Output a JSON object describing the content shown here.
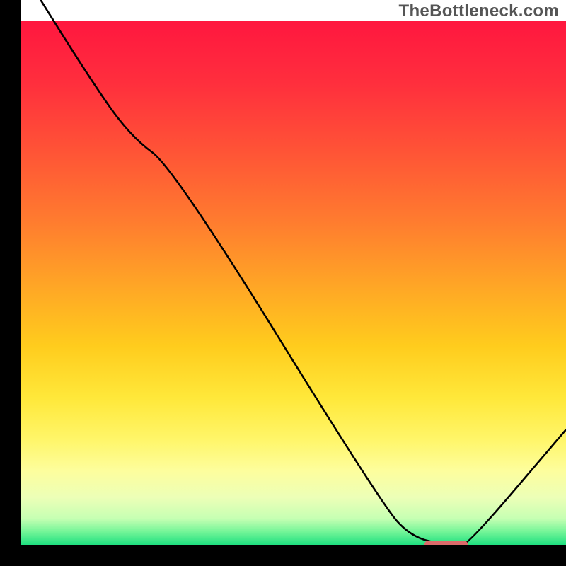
{
  "watermark": "TheBottleneck.com",
  "chart_data": {
    "type": "line",
    "title": "",
    "xlabel": "",
    "ylabel": "",
    "x": [
      0,
      12,
      20,
      28,
      66,
      72,
      80,
      82,
      100
    ],
    "values": [
      110,
      90,
      78,
      72,
      8,
      1,
      0,
      0,
      22
    ],
    "ylim": [
      0,
      100
    ],
    "xlim": [
      0,
      100
    ],
    "grid": false,
    "marker": {
      "x_start": 74,
      "x_end": 82,
      "y": 0,
      "color": "#db6a6a"
    },
    "gradient_stops": [
      {
        "offset": 0.0,
        "color": "#ff173f"
      },
      {
        "offset": 0.12,
        "color": "#ff2f3d"
      },
      {
        "offset": 0.25,
        "color": "#ff5436"
      },
      {
        "offset": 0.38,
        "color": "#ff7b2f"
      },
      {
        "offset": 0.5,
        "color": "#ffa426"
      },
      {
        "offset": 0.62,
        "color": "#ffcc1d"
      },
      {
        "offset": 0.72,
        "color": "#ffe83a"
      },
      {
        "offset": 0.8,
        "color": "#fff66a"
      },
      {
        "offset": 0.86,
        "color": "#fdfe9e"
      },
      {
        "offset": 0.91,
        "color": "#ecffb7"
      },
      {
        "offset": 0.95,
        "color": "#c6ffb3"
      },
      {
        "offset": 0.975,
        "color": "#74f598"
      },
      {
        "offset": 1.0,
        "color": "#1fe080"
      }
    ]
  }
}
